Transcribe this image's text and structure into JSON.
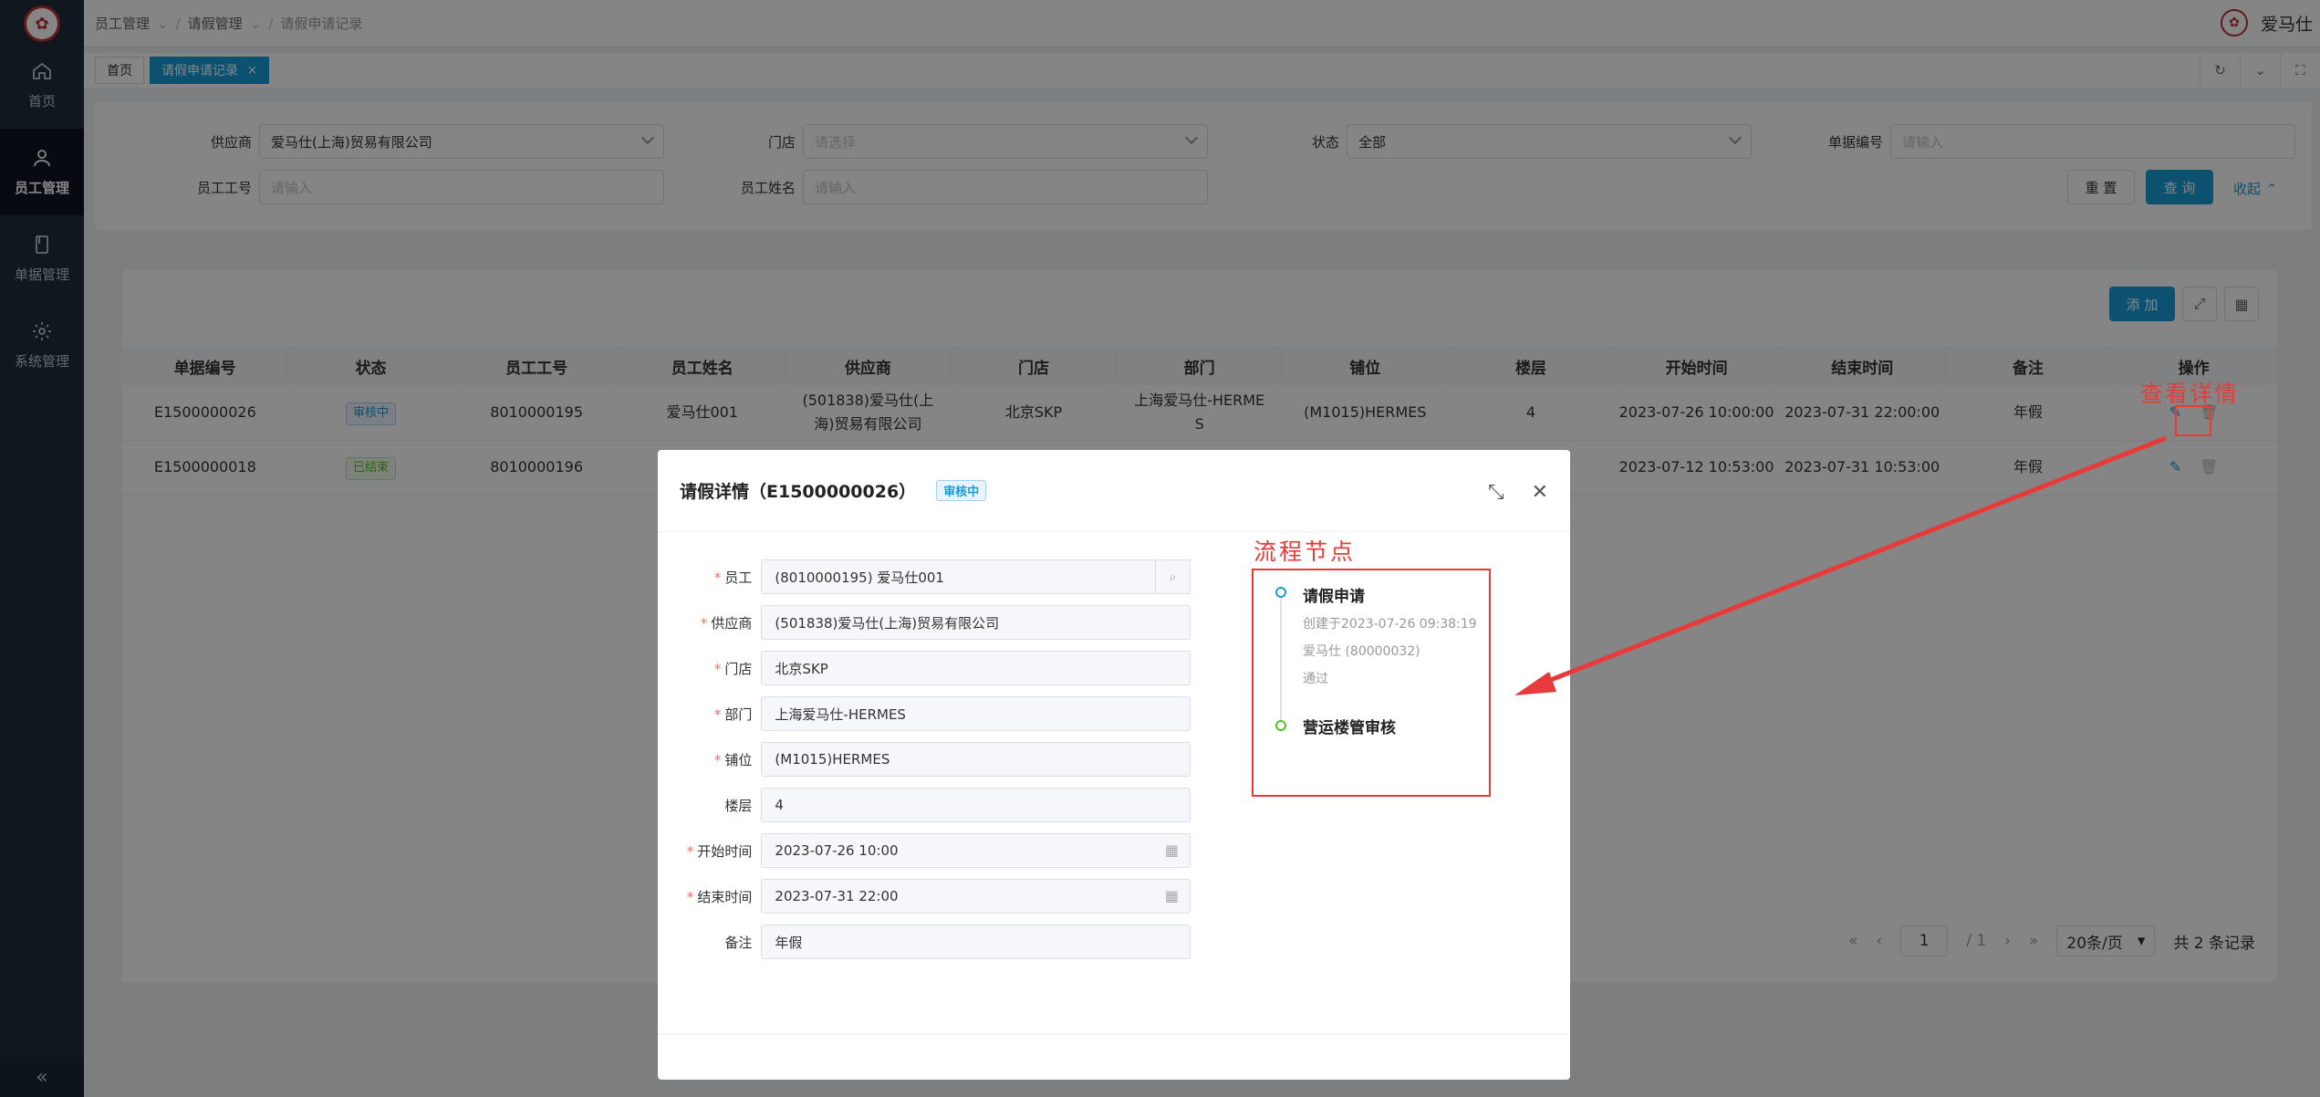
{
  "header": {
    "logo_text": "",
    "breadcrumb": [
      "员工管理",
      "请假管理",
      "请假申请记录"
    ],
    "user_name": "爱马仕"
  },
  "sidebar": {
    "items": [
      {
        "label": "首页",
        "icon": "home-icon"
      },
      {
        "label": "员工管理",
        "icon": "user-icon",
        "active": true
      },
      {
        "label": "单据管理",
        "icon": "document-icon"
      },
      {
        "label": "系统管理",
        "icon": "gear-icon"
      }
    ],
    "collapse_icon": "«"
  },
  "tabs": [
    {
      "label": "首页",
      "active": false
    },
    {
      "label": "请假申请记录",
      "active": true,
      "close": "×"
    }
  ],
  "search": {
    "supplier_label": "供应商",
    "supplier_value": "爱马仕(上海)贸易有限公司",
    "store_label": "门店",
    "store_placeholder": "请选择",
    "status_label": "状态",
    "status_value": "全部",
    "doc_no_label": "单据编号",
    "doc_no_placeholder": "请输入",
    "emp_no_label": "员工工号",
    "emp_no_placeholder": "请输入",
    "emp_name_label": "员工姓名",
    "emp_name_placeholder": "请输入",
    "reset_label": "重 置",
    "query_label": "查 询",
    "collapse_label": "收起"
  },
  "table": {
    "add_label": "添 加",
    "columns": [
      "单据编号",
      "状态",
      "员工工号",
      "员工姓名",
      "供应商",
      "门店",
      "部门",
      "铺位",
      "楼层",
      "开始时间",
      "结束时间",
      "备注",
      "操作"
    ],
    "rows": [
      {
        "doc_no": "E1500000026",
        "status": "审核中",
        "emp_no": "8010000195",
        "emp_name": "爱马仕001",
        "supplier": "(501838)爱马仕(上海)贸易有限公司",
        "store": "北京SKP",
        "dept": "上海爱马仕-HERMES",
        "booth": "(M1015)HERMES",
        "floor": "4",
        "start": "2023-07-26 10:00:00",
        "end": "2023-07-31 22:00:00",
        "remark": "年假"
      },
      {
        "doc_no": "E1500000018",
        "status": "已结束",
        "emp_no": "8010000196",
        "emp_name": "",
        "supplier": "",
        "store": "",
        "dept": "",
        "booth": "",
        "floor": "",
        "start": "2023-07-12 10:53:00",
        "end": "2023-07-31 10:53:00",
        "remark": "年假"
      }
    ]
  },
  "pager": {
    "page": "1",
    "total_pages": "/ 1",
    "page_size": "20条/页",
    "total": "共 2 条记录"
  },
  "modal": {
    "title": "请假详情（E1500000026）",
    "status_badge": "审核中",
    "fields": [
      {
        "label": "员工",
        "required": true,
        "value": "(8010000195) 爱马仕001"
      },
      {
        "label": "供应商",
        "required": true,
        "value": "(501838)爱马仕(上海)贸易有限公司"
      },
      {
        "label": "门店",
        "required": true,
        "value": "北京SKP"
      },
      {
        "label": "部门",
        "required": true,
        "value": "上海爱马仕-HERMES"
      },
      {
        "label": "铺位",
        "required": true,
        "value": "(M1015)HERMES"
      },
      {
        "label": "楼层",
        "required": false,
        "value": "4"
      },
      {
        "label": "开始时间",
        "required": true,
        "value": "2023-07-26 10:00"
      },
      {
        "label": "结束时间",
        "required": true,
        "value": "2023-07-31 22:00"
      },
      {
        "label": "备注",
        "required": false,
        "value": "年假"
      }
    ],
    "flow_title": "流程节点",
    "flow": [
      {
        "name": "请假申请",
        "created": "创建于2023-07-26 09:38:19",
        "user": "爱马仕 (80000032)",
        "result": "通过"
      },
      {
        "name": "营运楼管审核"
      }
    ]
  },
  "annotation": {
    "label": "查看详情",
    "color": "#e83a3a"
  },
  "colors": {
    "primary": "#1a9bd6",
    "sidebar_bg": "#1f2d3d",
    "required": "#f56c6c"
  }
}
